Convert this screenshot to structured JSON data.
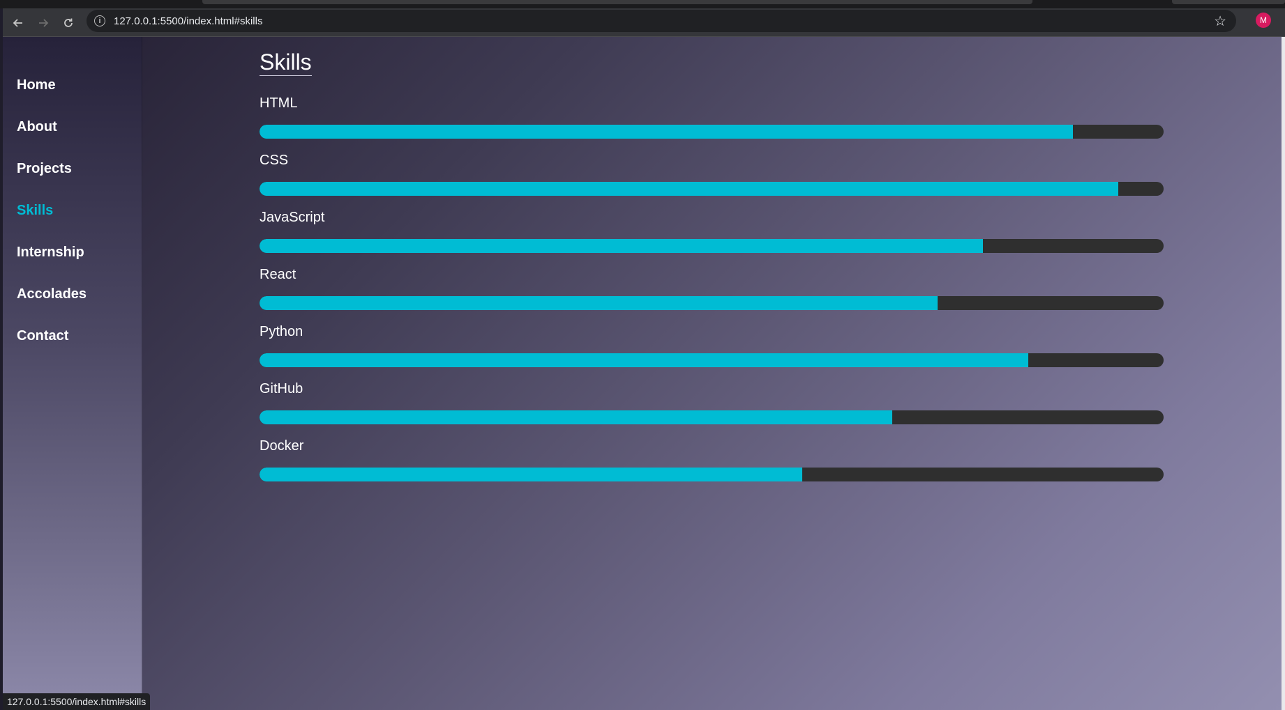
{
  "browser": {
    "url": "127.0.0.1:5500/index.html#skills",
    "status_url": "127.0.0.1:5500/index.html#skills",
    "profile_initial": "M"
  },
  "sidebar": {
    "items": [
      {
        "label": "Home",
        "active": false
      },
      {
        "label": "About",
        "active": false
      },
      {
        "label": "Projects",
        "active": false
      },
      {
        "label": "Skills",
        "active": true
      },
      {
        "label": "Internship",
        "active": false
      },
      {
        "label": "Accolades",
        "active": false
      },
      {
        "label": "Contact",
        "active": false
      }
    ]
  },
  "main": {
    "title": "Skills",
    "skills": [
      {
        "name": "HTML",
        "level_percent": 90
      },
      {
        "name": "CSS",
        "level_percent": 95
      },
      {
        "name": "JavaScript",
        "level_percent": 80
      },
      {
        "name": "React",
        "level_percent": 75
      },
      {
        "name": "Python",
        "level_percent": 85
      },
      {
        "name": "GitHub",
        "level_percent": 70
      },
      {
        "name": "Docker",
        "level_percent": 60
      }
    ]
  },
  "colors": {
    "accent": "#00bcd4",
    "bar_track": "#2f2f2f"
  }
}
